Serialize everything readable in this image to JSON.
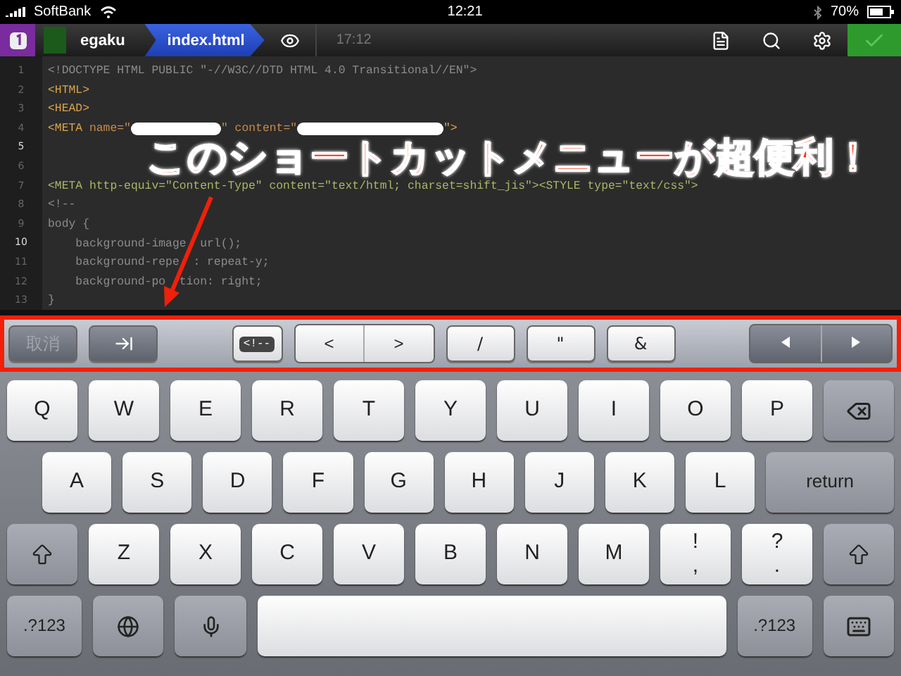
{
  "status_bar": {
    "carrier": "SoftBank",
    "time": "12:21",
    "battery": "70%"
  },
  "toolbar": {
    "breadcrumbs": [
      {
        "label": "egaku",
        "selected": false
      },
      {
        "label": "index.html",
        "selected": true
      }
    ],
    "time": "17:12"
  },
  "editor": {
    "lines": [
      {
        "number": "1",
        "current": false,
        "segments": [
          {
            "kind": "comment",
            "text": "<!DOCTYPE HTML PUBLIC \"-//W3C//DTD HTML 4.0 Transitional//EN\">"
          }
        ]
      },
      {
        "number": "2",
        "current": false,
        "segments": [
          {
            "kind": "tag",
            "text": "<HTML>"
          }
        ]
      },
      {
        "number": "3",
        "current": false,
        "segments": [
          {
            "kind": "tag",
            "text": "<HEAD>"
          }
        ]
      },
      {
        "number": "4",
        "current": false,
        "segments": [
          {
            "kind": "tag",
            "text": "<META "
          },
          {
            "kind": "attr",
            "text": "name=\""
          },
          {
            "kind": "redacted"
          },
          {
            "kind": "attr",
            "text": "\" content=\""
          },
          {
            "kind": "redacted"
          },
          {
            "kind": "tag",
            "text": "\">"
          }
        ]
      },
      {
        "number": "5",
        "current": true
      },
      {
        "number": "6",
        "current": false
      },
      {
        "number": "7",
        "current": false,
        "segments": [
          {
            "kind": "string",
            "text": "<META http-equiv=\"Content-Type\" content=\"text/html; charset=shift_jis\"><STYLE type=\"text/css\">"
          }
        ]
      },
      {
        "number": "8",
        "current": false,
        "segments": [
          {
            "kind": "comment",
            "text": "<!--"
          }
        ]
      },
      {
        "number": "9",
        "current": false,
        "segments": [
          {
            "kind": "comment",
            "text": "body {"
          }
        ]
      },
      {
        "number": "10",
        "current": true,
        "segments": [
          {
            "kind": "comment",
            "text": "    background-image"
          },
          {
            "kind": "covered"
          },
          {
            "kind": "comment",
            "text": "url();"
          }
        ]
      },
      {
        "number": "11",
        "current": false,
        "segments": [
          {
            "kind": "comment",
            "text": "    background-repe"
          },
          {
            "kind": "covered"
          },
          {
            "kind": "comment",
            "text": ": repeat-y;"
          }
        ]
      },
      {
        "number": "12",
        "current": false,
        "segments": [
          {
            "kind": "comment",
            "text": "    background-po"
          },
          {
            "kind": "covered"
          },
          {
            "kind": "comment",
            "text": "tion: right;"
          }
        ]
      },
      {
        "number": "13",
        "current": false,
        "segments": [
          {
            "kind": "comment",
            "text": "}"
          }
        ]
      }
    ]
  },
  "annotation": {
    "text": "このショートカットメニューが超便利！"
  },
  "shortcuts": [
    {
      "kind": "text",
      "label": "取消",
      "disabled": true,
      "dark": true
    },
    {
      "kind": "tab",
      "dark": true
    },
    {
      "kind": "spacer"
    },
    {
      "kind": "comment",
      "label": "<!--"
    },
    {
      "kind": "pair",
      "labels": [
        "<",
        ">"
      ]
    },
    {
      "kind": "text",
      "label": "/",
      "disabled": false,
      "dark": false
    },
    {
      "kind": "text",
      "label": "\"",
      "disabled": false,
      "dark": false
    },
    {
      "kind": "text",
      "label": "&",
      "disabled": false,
      "dark": false
    },
    {
      "kind": "spacer"
    },
    {
      "kind": "arrows",
      "dark": true
    }
  ],
  "keyboard": {
    "rows": [
      {
        "keys": [
          {
            "kind": "letter",
            "label": "Q"
          },
          {
            "kind": "letter",
            "label": "W"
          },
          {
            "kind": "letter",
            "label": "E"
          },
          {
            "kind": "letter",
            "label": "R"
          },
          {
            "kind": "letter",
            "label": "T"
          },
          {
            "kind": "letter",
            "label": "Y"
          },
          {
            "kind": "letter",
            "label": "U"
          },
          {
            "kind": "letter",
            "label": "I"
          },
          {
            "kind": "letter",
            "label": "O"
          },
          {
            "kind": "letter",
            "label": "P"
          },
          {
            "kind": "delete"
          }
        ]
      },
      {
        "keys": [
          {
            "kind": "letter",
            "label": "A"
          },
          {
            "kind": "letter",
            "label": "S"
          },
          {
            "kind": "letter",
            "label": "D"
          },
          {
            "kind": "letter",
            "label": "F"
          },
          {
            "kind": "letter",
            "label": "G"
          },
          {
            "kind": "letter",
            "label": "H"
          },
          {
            "kind": "letter",
            "label": "J"
          },
          {
            "kind": "letter",
            "label": "K"
          },
          {
            "kind": "letter",
            "label": "L"
          },
          {
            "kind": "return",
            "label": "return"
          }
        ]
      },
      {
        "keys": [
          {
            "kind": "shift"
          },
          {
            "kind": "letter",
            "label": "Z"
          },
          {
            "kind": "letter",
            "label": "X"
          },
          {
            "kind": "letter",
            "label": "C"
          },
          {
            "kind": "letter",
            "label": "V"
          },
          {
            "kind": "letter",
            "label": "B"
          },
          {
            "kind": "letter",
            "label": "N"
          },
          {
            "kind": "letter",
            "label": "M"
          },
          {
            "kind": "dual",
            "label": "!",
            "sub": ","
          },
          {
            "kind": "dual",
            "label": "?",
            "sub": "."
          },
          {
            "kind": "shift"
          }
        ]
      },
      {
        "keys": [
          {
            "kind": "mode",
            "label": ".?123"
          },
          {
            "kind": "globe"
          },
          {
            "kind": "mic"
          },
          {
            "kind": "space"
          },
          {
            "kind": "mode",
            "label": ".?123"
          },
          {
            "kind": "hide"
          }
        ]
      }
    ]
  }
}
